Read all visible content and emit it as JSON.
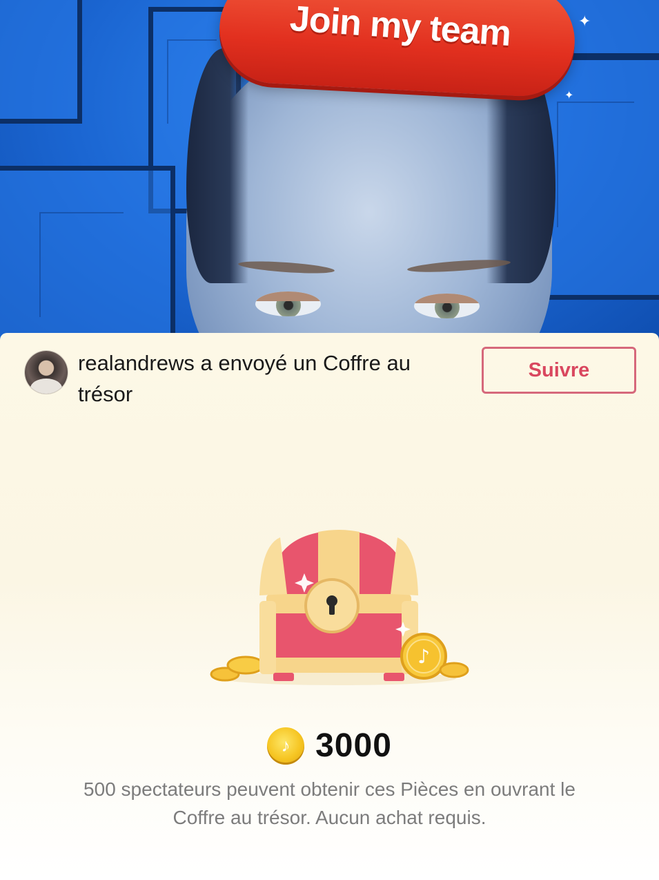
{
  "overlay": {
    "join_label": "Join my team"
  },
  "notification": {
    "username": "realandrews",
    "message": "realandrews a envoyé un Coffre au trésor",
    "follow_label": "Suivre"
  },
  "reward": {
    "coin_icon": "tiktok-coin-icon",
    "amount": "3000",
    "description": "500 spectateurs peuvent obtenir ces Pièces en ouvrant le Coffre au trésor. Aucun achat requis."
  },
  "colors": {
    "accent_red": "#e2301f",
    "follow_border": "#d6687b",
    "follow_text": "#d9475f",
    "coin_gold": "#f6c522",
    "chest_pink": "#e8556d",
    "chest_gold": "#f7d58b"
  }
}
